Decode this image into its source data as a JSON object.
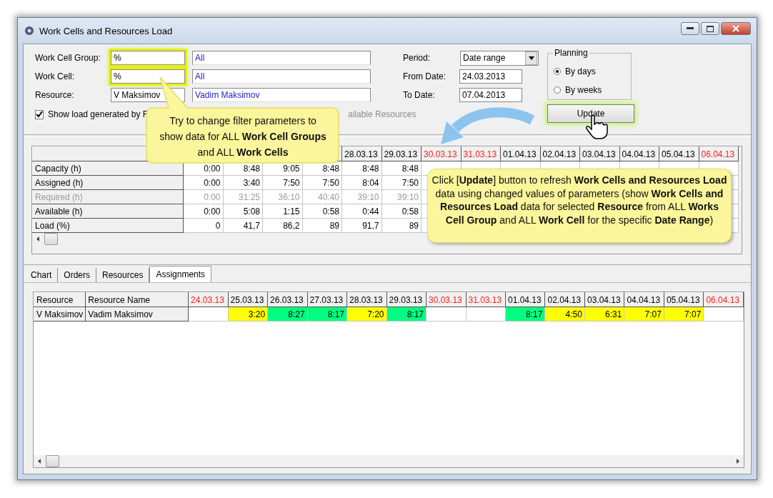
{
  "window": {
    "title": "Work Cells and Resources Load"
  },
  "filters": [
    {
      "label": "Work Cell Group:",
      "code": "%",
      "name": "All",
      "highlighted": true
    },
    {
      "label": "Work Cell:",
      "code": "%",
      "name": "All",
      "highlighted": true
    },
    {
      "label": "Resource:",
      "code": "V Maksimov",
      "name": "Vadim Maksimov",
      "highlighted": false
    }
  ],
  "show_load": {
    "label": "Show load generated by F",
    "checked": true
  },
  "available_resources": {
    "label": "ailable Resources",
    "disabled": true
  },
  "period": {
    "label": "Period:",
    "value": "Date range"
  },
  "from_date": {
    "label": "From Date:",
    "value": "24.03.2013"
  },
  "to_date": {
    "label": "To Date:",
    "value": "07.04.2013"
  },
  "planning": {
    "title": "Planning",
    "options": [
      {
        "label": "By days",
        "selected": true
      },
      {
        "label": "By weeks",
        "selected": false
      }
    ]
  },
  "update_button": {
    "label": "Update",
    "highlighted": true
  },
  "load_grid": {
    "columns": [
      {},
      {},
      {},
      {},
      {
        "label": "28.03.13",
        "weekend": false
      },
      {
        "label": "29.03.13",
        "weekend": false
      },
      {
        "label": "30.03.13",
        "weekend": true
      },
      {
        "label": "31.03.13",
        "weekend": true
      },
      {
        "label": "01.04.13",
        "weekend": false
      },
      {
        "label": "02.04.13",
        "weekend": false
      },
      {
        "label": "03.04.13",
        "weekend": false
      },
      {
        "label": "04.04.13",
        "weekend": false
      },
      {
        "label": "05.04.13",
        "weekend": false
      },
      {
        "label": "06.04.13",
        "weekend": true
      }
    ],
    "rows": [
      {
        "label": "Capacity (h)",
        "disabled": false,
        "values": [
          "0:00",
          "8:48",
          "9:05",
          "8:48",
          "8:48",
          "8:48"
        ]
      },
      {
        "label": "Assigned (h)",
        "disabled": false,
        "values": [
          "0:00",
          "3:40",
          "7:50",
          "7:50",
          "8:04",
          "7:50"
        ]
      },
      {
        "label": "Required (h)",
        "disabled": true,
        "values": [
          "0:00",
          "31:25",
          "36:10",
          "40:40",
          "39:10",
          "39:10"
        ]
      },
      {
        "label": "Available (h)",
        "disabled": false,
        "values": [
          "0:00",
          "5:08",
          "1:15",
          "0:58",
          "0:44",
          "0:58"
        ]
      },
      {
        "label": "Load (%)",
        "disabled": false,
        "values": [
          "0",
          "41,7",
          "86,2",
          "89",
          "91,7",
          "89"
        ]
      }
    ]
  },
  "tabs": [
    {
      "label": "Chart",
      "selected": false
    },
    {
      "label": "Orders",
      "selected": false
    },
    {
      "label": "Resources",
      "selected": false
    },
    {
      "label": "Assignments",
      "selected": true
    }
  ],
  "assignments": {
    "columns": [
      "Resource",
      "Resource Name"
    ],
    "dates": [
      {
        "label": "24.03.13",
        "weekend": true
      },
      {
        "label": "25.03.13",
        "weekend": false
      },
      {
        "label": "26.03.13",
        "weekend": false
      },
      {
        "label": "27.03.13",
        "weekend": false
      },
      {
        "label": "28.03.13",
        "weekend": false
      },
      {
        "label": "29.03.13",
        "weekend": false
      },
      {
        "label": "30.03.13",
        "weekend": true
      },
      {
        "label": "31.03.13",
        "weekend": true
      },
      {
        "label": "01.04.13",
        "weekend": false
      },
      {
        "label": "02.04.13",
        "weekend": false
      },
      {
        "label": "03.04.13",
        "weekend": false
      },
      {
        "label": "04.04.13",
        "weekend": false
      },
      {
        "label": "05.04.13",
        "weekend": false
      },
      {
        "label": "06.04.13",
        "weekend": true
      }
    ],
    "rows": [
      {
        "resource": "V Maksimov",
        "name": "Vadim Maksimov",
        "cells": [
          {},
          {
            "value": "3:20",
            "color": "#ffff00"
          },
          {
            "value": "8:27",
            "color": "#00ff80"
          },
          {
            "value": "8:17",
            "color": "#00ff80"
          },
          {
            "value": "7:20",
            "color": "#ffff00"
          },
          {
            "value": "8:17",
            "color": "#00ff80"
          },
          {},
          {},
          {
            "value": "8:17",
            "color": "#00ff80"
          },
          {
            "value": "4:50",
            "color": "#ffff00"
          },
          {
            "value": "6:31",
            "color": "#ffff00"
          },
          {
            "value": "7:07",
            "color": "#ffff00"
          },
          {
            "value": "7:07",
            "color": "#ffff00"
          },
          {}
        ]
      }
    ]
  },
  "callouts": [
    {
      "text": "Try to change filter parameters to show data for ALL **Work Cell Groups** and ALL **Work Cells**"
    },
    {
      "text": "Click [**Update**] button to refresh **Work Cells and Resources Load** data using changed values of parameters (show **Work Cells and Resources Load** data for selected **Resource** from ALL **Works Cell Group** and ALL **Work Cell** for the specific **Date Range**)"
    }
  ]
}
